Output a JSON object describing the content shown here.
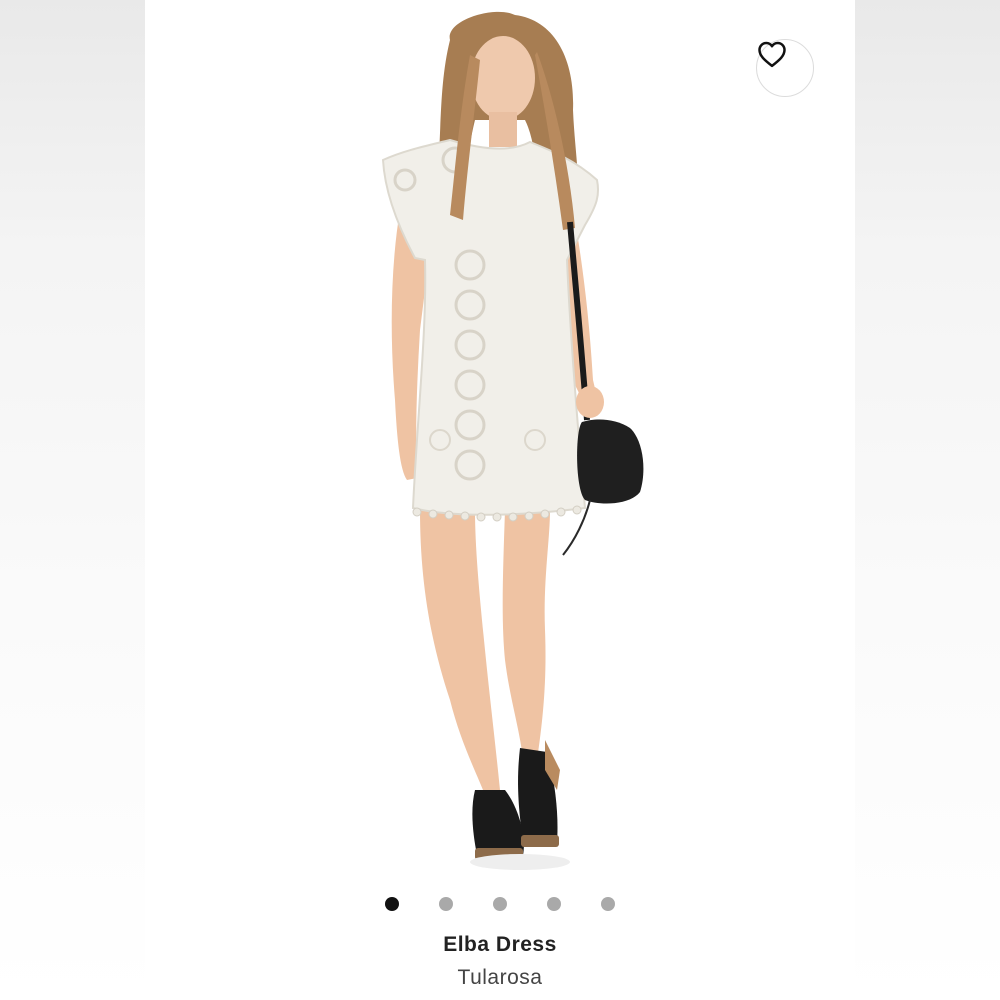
{
  "product": {
    "name": "Elba Dress",
    "brand": "Tularosa"
  },
  "gallery": {
    "image_count": 5,
    "active_index": 0
  },
  "favorite_icon": "heart-outline-icon",
  "colors": {
    "dot_active": "#111111",
    "dot_inactive": "#a9a9a9",
    "background": "#ffffff"
  }
}
